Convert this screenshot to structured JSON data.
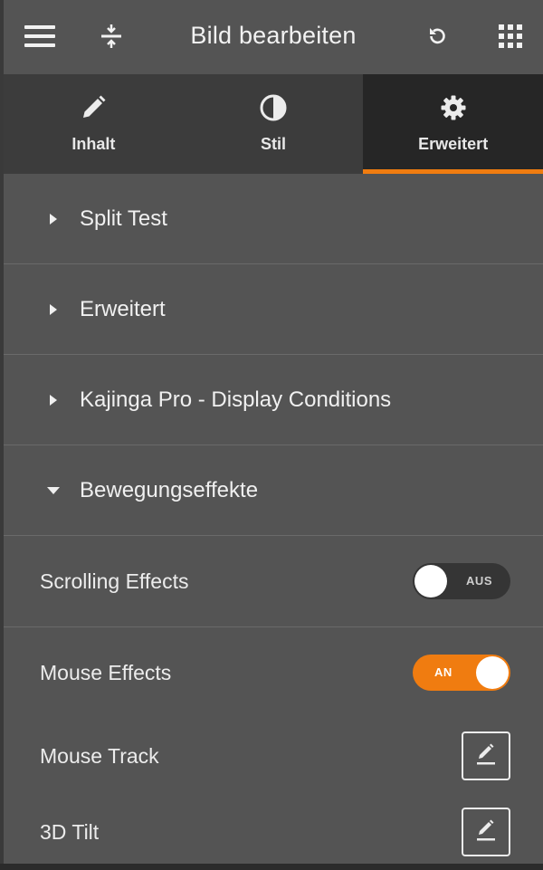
{
  "header": {
    "title": "Bild bearbeiten",
    "icons": [
      "menu-icon",
      "expand-icon",
      "undo-icon",
      "apps-grid-icon"
    ]
  },
  "tabs": [
    {
      "label": "Inhalt",
      "icon": "pencil-icon",
      "active": false
    },
    {
      "label": "Stil",
      "icon": "contrast-icon",
      "active": false
    },
    {
      "label": "Erweitert",
      "icon": "gear-icon",
      "active": true
    }
  ],
  "sections": [
    {
      "label": "Split Test",
      "expanded": false
    },
    {
      "label": "Erweitert",
      "expanded": false
    },
    {
      "label": "Kajinga Pro - Display Conditions",
      "expanded": false
    },
    {
      "label": "Bewegungseffekte",
      "expanded": true
    }
  ],
  "motion": {
    "scrolling": {
      "label": "Scrolling Effects",
      "toggle": "AUS",
      "on": false
    },
    "mouse": {
      "label": "Mouse Effects",
      "toggle": "AN",
      "on": true
    },
    "mouse_track": {
      "label": "Mouse Track"
    },
    "tilt": {
      "label": "3D Tilt"
    }
  },
  "colors": {
    "accent": "#f07c10",
    "panel": "#545454",
    "tab_bar": "#3c3c3c",
    "active_tab": "#262626"
  }
}
